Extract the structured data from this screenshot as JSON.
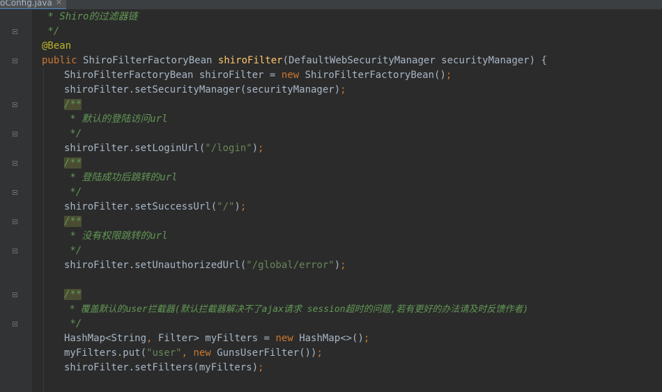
{
  "tab": {
    "filename": "oConfig.java",
    "close_glyph": "✕"
  },
  "code": {
    "l1": {
      "star": " * ",
      "text": "Shiro的过滤器链"
    },
    "l2": {
      "text": " */"
    },
    "l3": {
      "text": "@Bean"
    },
    "l4": {
      "kw": "public",
      "type": "ShiroFilterFactoryBean",
      "fn": "shiroFilter",
      "params": "(DefaultWebSecurityManager securityManager) {"
    },
    "l5": {
      "decl": "ShiroFilterFactoryBean shiroFilter = ",
      "kw": "new",
      "rest": " ShiroFilterFactoryBean()",
      "semi": ";"
    },
    "l6": {
      "text": "shiroFilter.setSecurityManager(securityManager)",
      "semi": ";"
    },
    "l7": {
      "open": "/**"
    },
    "l8": {
      "text": " * 默认的登陆访问url"
    },
    "l9": {
      "text": " */"
    },
    "l10": {
      "pre": "shiroFilter.setLoginUrl(",
      "str": "\"/login\"",
      "post": ")",
      "semi": ";"
    },
    "l11": {
      "open": "/**"
    },
    "l12": {
      "text": " * 登陆成功后跳转的url"
    },
    "l13": {
      "text": " */"
    },
    "l14": {
      "pre": "shiroFilter.setSuccessUrl(",
      "str": "\"/\"",
      "post": ")",
      "semi": ";"
    },
    "l15": {
      "open": "/**"
    },
    "l16": {
      "text": " * 没有权限跳转的url"
    },
    "l17": {
      "text": " */"
    },
    "l18": {
      "pre": "shiroFilter.setUnauthorizedUrl(",
      "str": "\"/global/error\"",
      "post": ")",
      "semi": ";"
    },
    "l19": {
      "open": "/**"
    },
    "l20": {
      "text": " * 覆盖默认的user拦截器(默认拦截器解决不了ajax请求 session超时的问题,若有更好的办法请及时反馈作者)"
    },
    "l21": {
      "text": " */"
    },
    "l22": {
      "pre": "HashMap<String",
      "comma": ",",
      "mid": " Filter> myFilters = ",
      "kw": "new",
      "post": " HashMap<>()",
      "semi": ";"
    },
    "l23": {
      "pre": "myFilters.put(",
      "str": "\"user\"",
      "comma": ",",
      "sp": " ",
      "kw": "new",
      "post": " GunsUserFilter())",
      "semi": ";"
    },
    "l24": {
      "text": "shiroFilter.setFilters(myFilters)",
      "semi": ";"
    }
  }
}
